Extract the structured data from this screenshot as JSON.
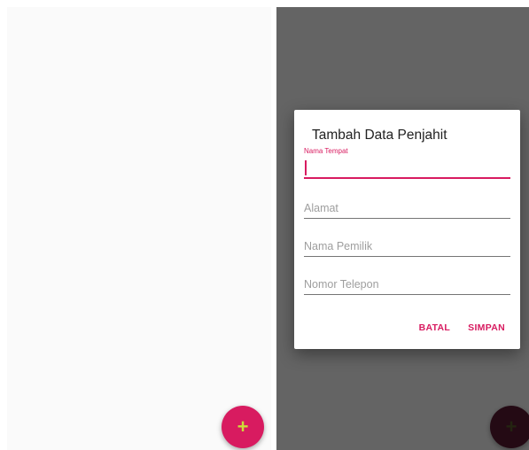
{
  "colors": {
    "accent": "#d81b60",
    "fab_icon": "#cddc39",
    "fab_left_bg": "#d81b60",
    "fab_right_bg": "#5b1a34",
    "fab_right_icon": "#5a5a2c"
  },
  "left_screen": {
    "fab": {
      "icon": "plus-icon",
      "glyph": "+"
    }
  },
  "right_screen": {
    "dialog": {
      "title": "Tambah Data Penjahit",
      "fields": [
        {
          "label": "Nama Tempat",
          "value": "",
          "focused": true
        },
        {
          "placeholder": "Alamat",
          "value": ""
        },
        {
          "placeholder": "Nama Pemilik",
          "value": ""
        },
        {
          "placeholder": "Nomor Telepon",
          "value": ""
        }
      ],
      "actions": {
        "cancel": "BATAL",
        "save": "SIMPAN"
      }
    },
    "fab": {
      "icon": "plus-icon",
      "glyph": "+"
    }
  }
}
